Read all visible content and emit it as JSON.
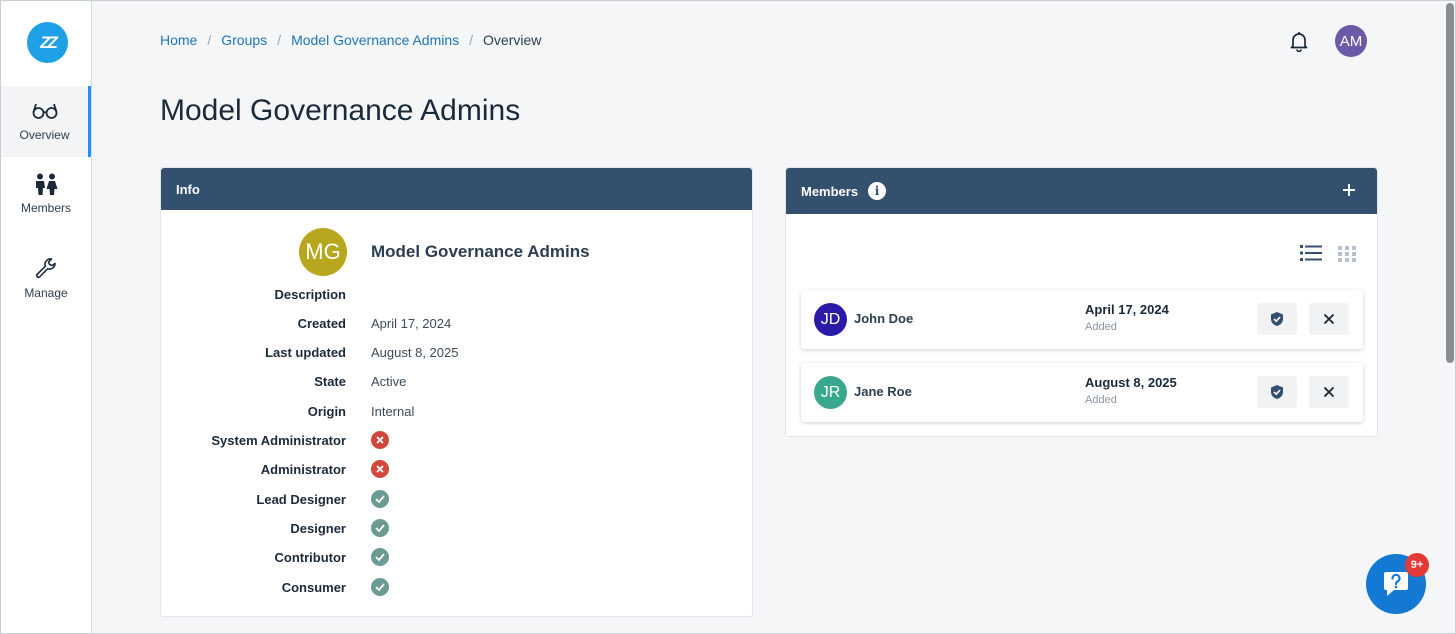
{
  "sidebar": {
    "logo_text": "ZZ",
    "items": [
      {
        "label": "Overview",
        "icon": "glasses-icon",
        "active": true
      },
      {
        "label": "Members",
        "icon": "people-icon",
        "active": false
      },
      {
        "label": "Manage",
        "icon": "wrench-icon",
        "active": false
      }
    ]
  },
  "breadcrumb": {
    "items": [
      "Home",
      "Groups",
      "Model Governance Admins"
    ],
    "current": "Overview"
  },
  "user": {
    "initials": "AM"
  },
  "page_title": "Model Governance Admins",
  "info": {
    "header": "Info",
    "avatar_initials": "MG",
    "name": "Model Governance Admins",
    "labels": {
      "description": "Description",
      "created": "Created",
      "last_updated": "Last updated",
      "state": "State",
      "origin": "Origin"
    },
    "values": {
      "description": "",
      "created": "April 17, 2024",
      "last_updated": "August 8, 2025",
      "state": "Active",
      "origin": "Internal"
    },
    "roles": [
      {
        "label": "System Administrator",
        "granted": false
      },
      {
        "label": "Administrator",
        "granted": false
      },
      {
        "label": "Lead Designer",
        "granted": true
      },
      {
        "label": "Designer",
        "granted": true
      },
      {
        "label": "Contributor",
        "granted": true
      },
      {
        "label": "Consumer",
        "granted": true
      }
    ]
  },
  "members": {
    "header": "Members",
    "info_glyph": "i",
    "list": [
      {
        "initials": "JD",
        "name": "John Doe",
        "date": "April 17, 2024",
        "status": "Added",
        "color": "#2a1aa8"
      },
      {
        "initials": "JR",
        "name": "Jane Roe",
        "date": "August 8, 2025",
        "status": "Added",
        "color": "#3aa88e"
      }
    ]
  },
  "help": {
    "badge": "9+"
  },
  "colors": {
    "header": "#34506f",
    "accent": "#1e90ff",
    "link": "#1f75b6"
  }
}
